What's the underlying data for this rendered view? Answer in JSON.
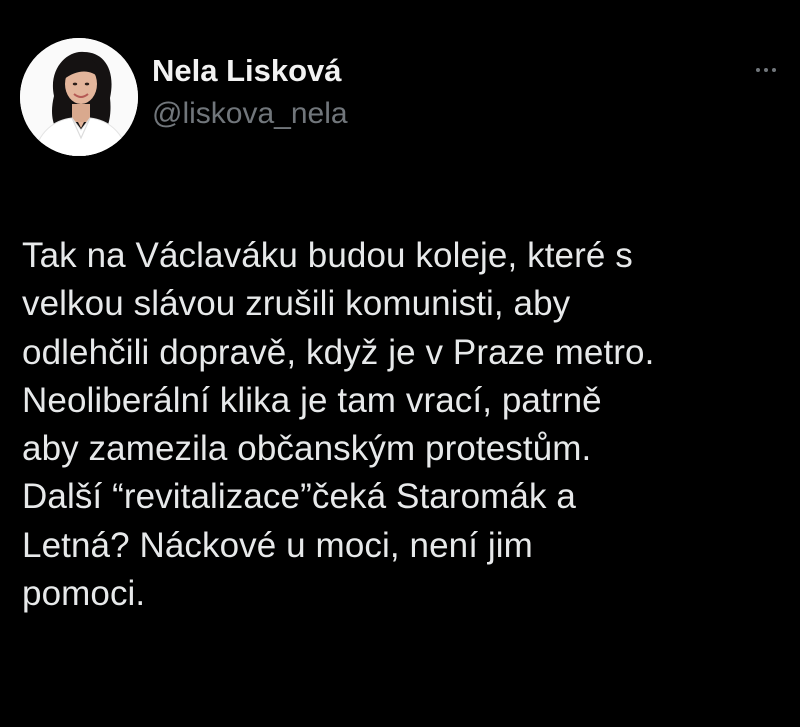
{
  "author": {
    "display_name": "Nela Lisková",
    "handle": "@liskova_nela",
    "avatar_icon": "profile-photo"
  },
  "more_icon": "more-horizontal-icon",
  "tweet": {
    "lines": [
      "Tak na Václaváku budou koleje, které s",
      "velkou slávou zrušili komunisti, aby",
      "odlehčili dopravě, když je v Praze metro.",
      "Neoliberální klika je tam vrací, patrně",
      "aby zamezila občanským protestům.",
      "Další “revitalizace”čeká Staromák a",
      "Letná?  Náckové u moci, není jim",
      "pomoci."
    ]
  },
  "colors": {
    "background": "#000000",
    "primary_text": "#e7e9ea",
    "secondary_text": "#71767b"
  }
}
